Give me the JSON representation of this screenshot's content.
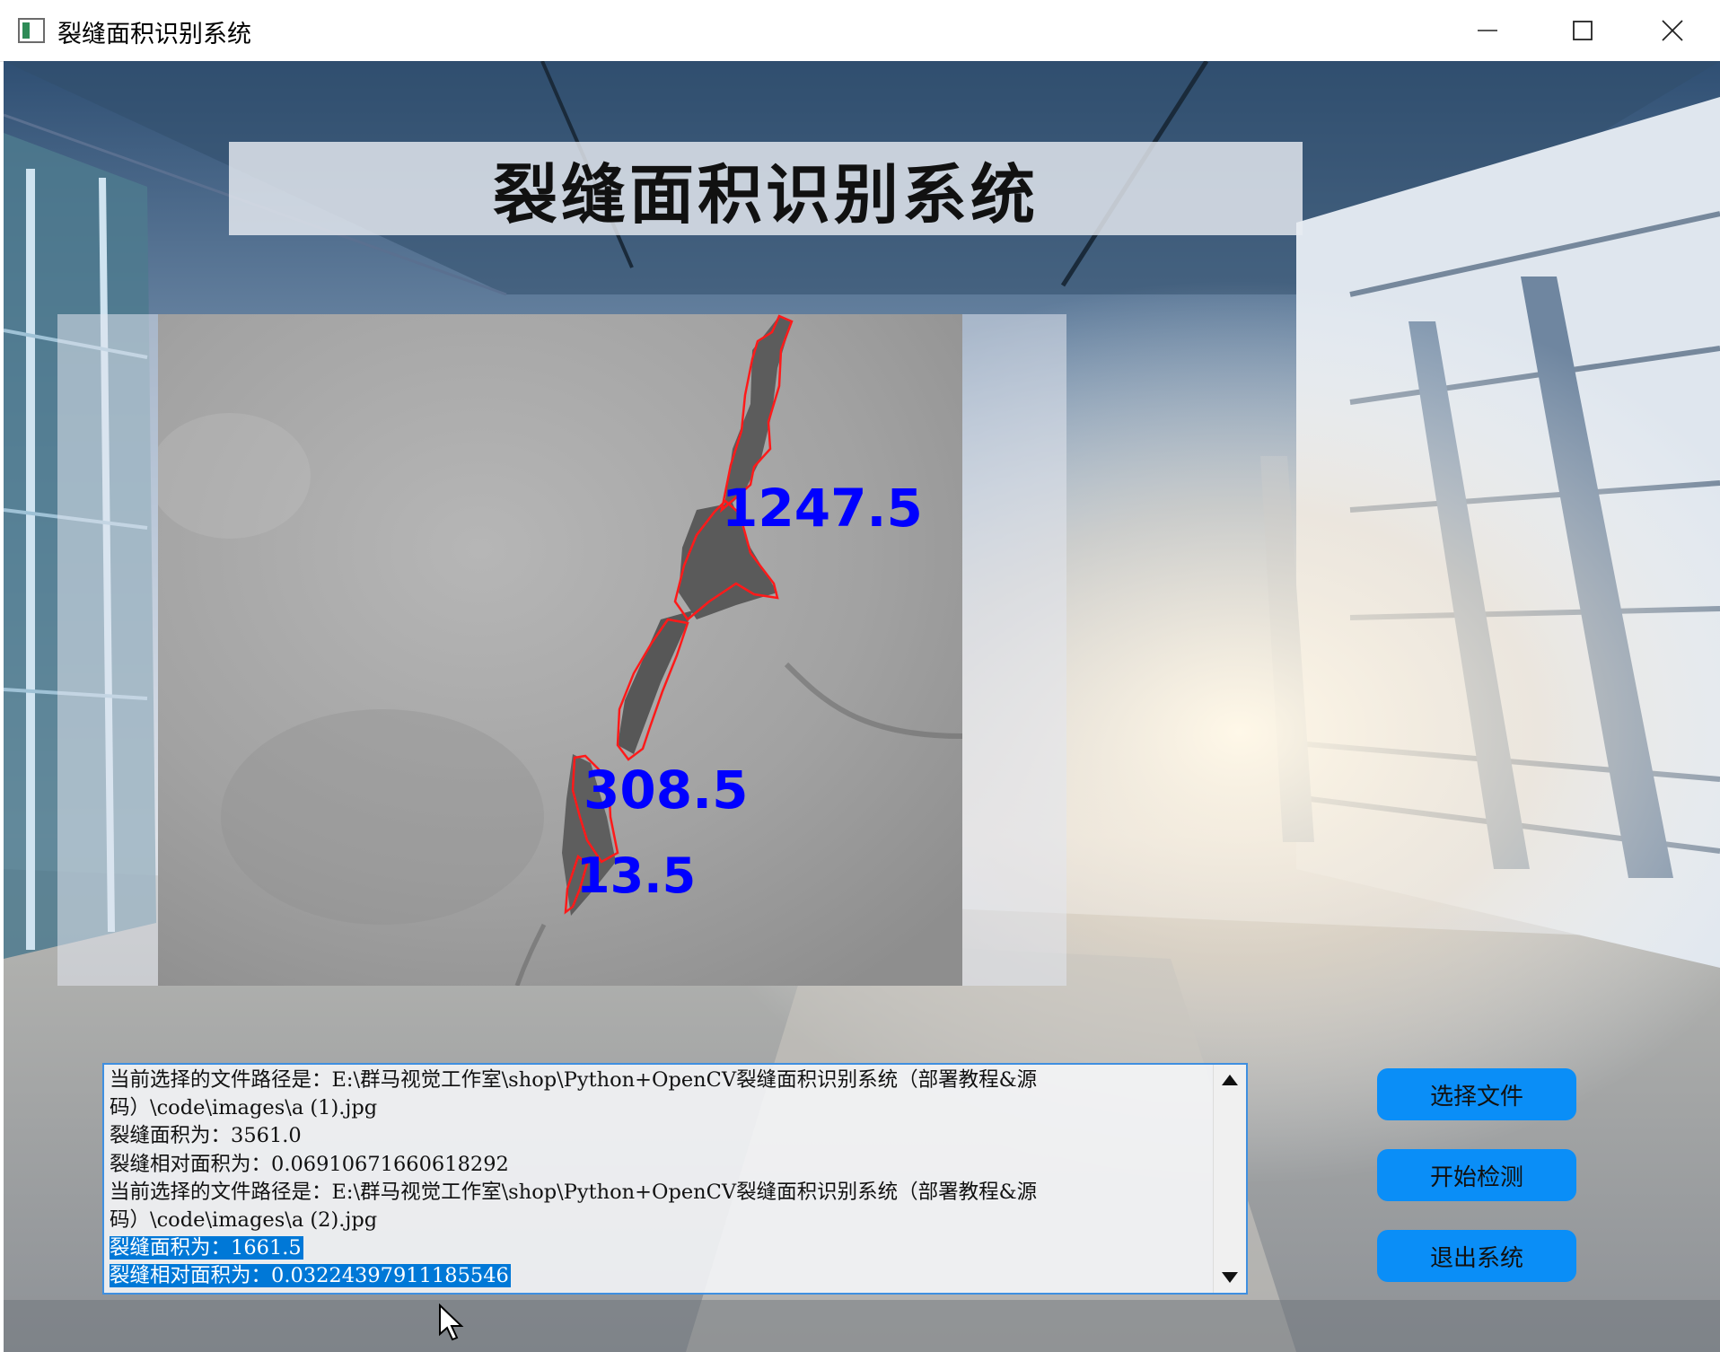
{
  "window": {
    "title": "裂缝面积识别系统"
  },
  "header": {
    "title": "裂缝面积识别系统"
  },
  "result_image": {
    "area_labels": [
      "1247.5",
      "308.5",
      "13.5"
    ],
    "contour_color": "#ff1a1a",
    "label_color": "#0000ff"
  },
  "log": {
    "lines": [
      "当前选择的文件路径是：E:\\群马视觉工作室\\shop\\Python+OpenCV裂缝面积识别系统（部署教程&源",
      "码）\\code\\images\\a (1).jpg",
      "裂缝面积为：3561.0",
      "裂缝相对面积为：0.06910671660618292",
      "当前选择的文件路径是：E:\\群马视觉工作室\\shop\\Python+OpenCV裂缝面积识别系统（部署教程&源",
      "码）\\code\\images\\a (2).jpg",
      "裂缝面积为：1661.5",
      "裂缝相对面积为：0.03224397911185546"
    ],
    "selected_lines": [
      6,
      7
    ]
  },
  "buttons": {
    "select_file": "选择文件",
    "start_detect": "开始检测",
    "exit_system": "退出系统"
  },
  "colors": {
    "button_bg": "#0a8ef7",
    "selection": "#0078d7",
    "log_border": "#3f8fe0"
  }
}
